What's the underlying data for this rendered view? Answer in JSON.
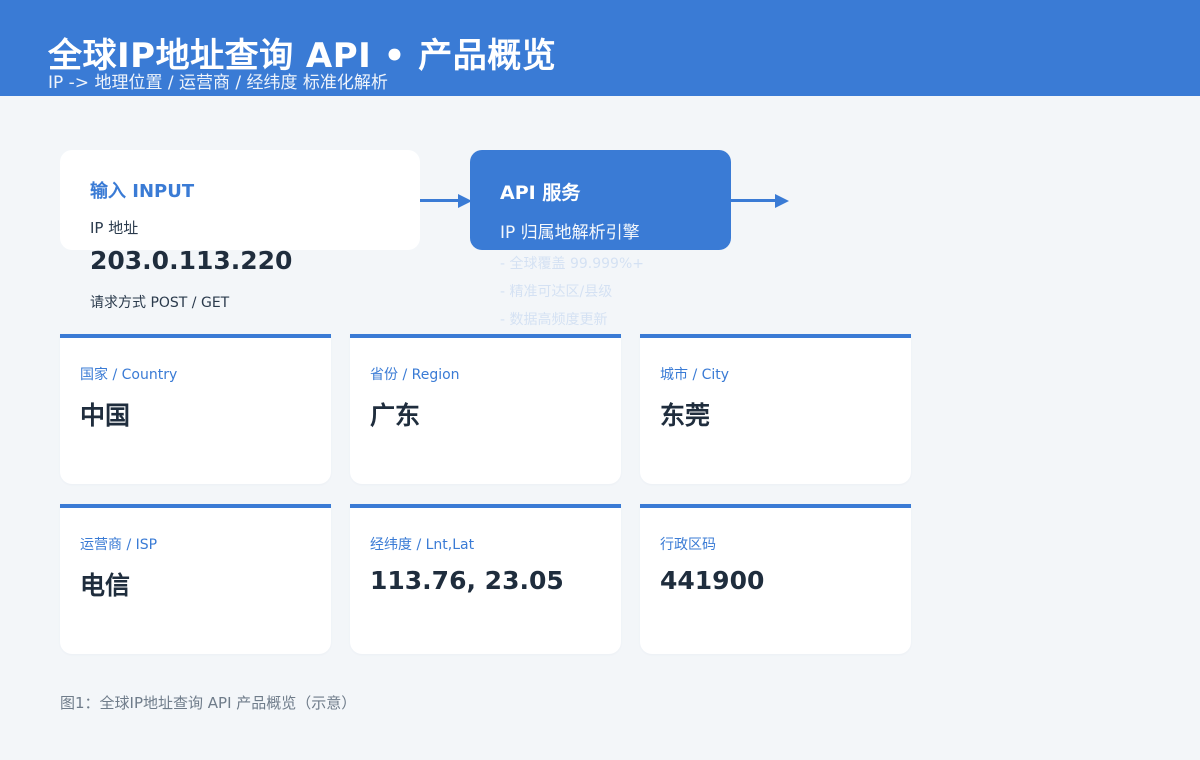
{
  "header": {
    "title": "全球IP地址查询 API • 产品概览",
    "subtitle": "IP -> 地理位置 / 运营商 / 经纬度 标准化解析"
  },
  "input": {
    "heading": "输入 INPUT",
    "label": "IP 地址",
    "value": "203.0.113.220",
    "method": "请求方式  POST / GET"
  },
  "api": {
    "title": "API 服务",
    "subtitle": "IP 归属地解析引擎",
    "features": [
      "- 全球覆盖 99.999%+",
      "- 精准可达区/县级",
      "- 数据高频度更新"
    ]
  },
  "results": [
    {
      "label": "国家 / Country",
      "value": "中国"
    },
    {
      "label": "省份 / Region",
      "value": "广东"
    },
    {
      "label": "城市 / City",
      "value": "东莞"
    },
    {
      "label": "运营商 / ISP",
      "value": "电信"
    },
    {
      "label": "经纬度 / Lnt,Lat",
      "value": "113.76, 23.05"
    },
    {
      "label": "行政区码",
      "value": "441900"
    }
  ],
  "caption": "图1：全球IP地址查询 API 产品概览（示意）",
  "colors": {
    "accent": "#3a7bd5",
    "background": "#f3f6f9",
    "card": "#ffffff",
    "text": "#1f2d3d"
  }
}
